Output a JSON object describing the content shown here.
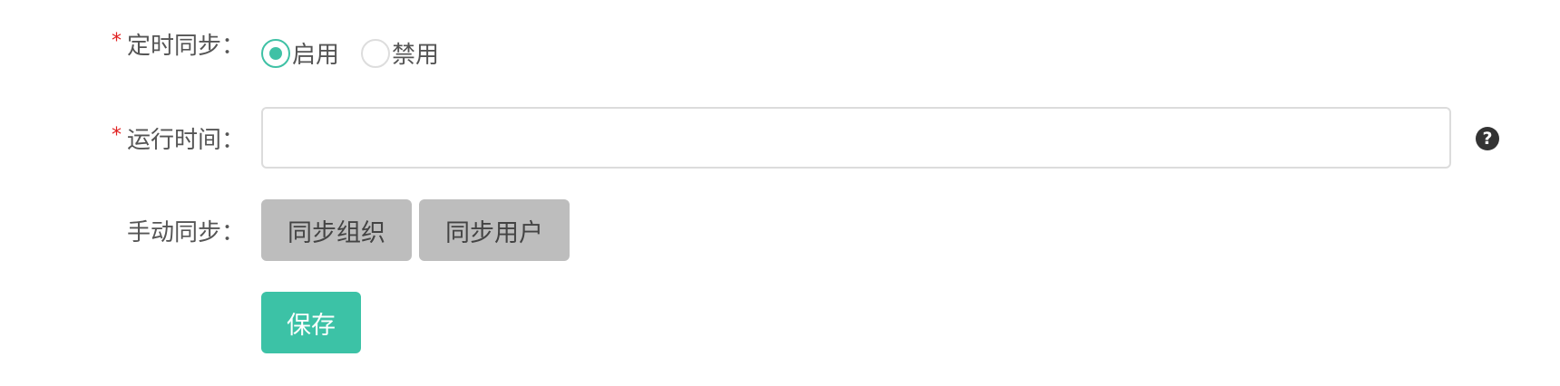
{
  "form": {
    "scheduled_sync": {
      "label": "定时同步：",
      "required_mark": "*",
      "options": [
        {
          "label": "启用",
          "checked": true
        },
        {
          "label": "禁用",
          "checked": false
        }
      ]
    },
    "run_time": {
      "label": "运行时间：",
      "required_mark": "*",
      "value": "",
      "placeholder": "",
      "help_icon": "question-circle-icon"
    },
    "manual_sync": {
      "label": "手动同步：",
      "sync_org_label": "同步组织",
      "sync_user_label": "同步用户"
    },
    "save_label": "保存"
  },
  "colors": {
    "accent": "#3cc2a6",
    "required": "#e02020",
    "button_gray": "#bdbdbd",
    "help_icon": "#333333"
  }
}
